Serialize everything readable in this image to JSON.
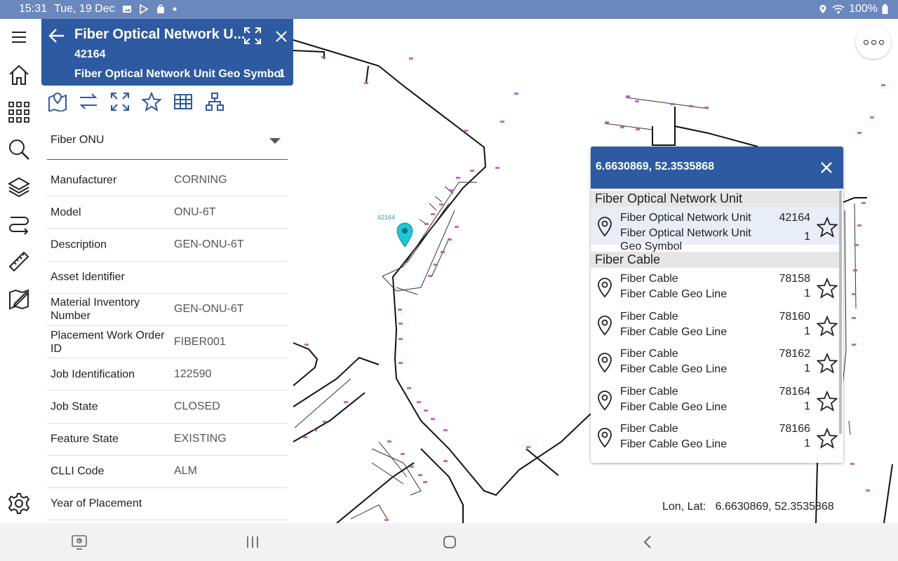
{
  "status_bar": {
    "time": "15:31",
    "date": "Tue, 19 Dec",
    "battery": "100%",
    "icons": [
      "photo-icon",
      "play-store-icon",
      "bag-icon",
      "dot-icon",
      "location-icon",
      "wifi-icon",
      "battery-icon"
    ]
  },
  "sidebar": {
    "items": [
      {
        "icon": "menu-icon"
      },
      {
        "icon": "home-icon"
      },
      {
        "icon": "apps-grid-icon"
      },
      {
        "icon": "search-icon"
      },
      {
        "icon": "layers-icon"
      },
      {
        "icon": "trace-icon"
      },
      {
        "icon": "measure-icon"
      },
      {
        "icon": "redline-icon"
      },
      {
        "icon": "settings-icon"
      }
    ]
  },
  "feature_panel": {
    "title": "Fiber Optical Network U...",
    "object_id": "42164",
    "subtype": "Fiber Optical Network Unit Geo Symbol",
    "count": "1",
    "toolbar_icons": [
      "map-zoom-icon",
      "swap-icon",
      "expand-icon",
      "favorite-star-icon",
      "table-icon",
      "hierarchy-icon"
    ],
    "layer_select": "Fiber ONU",
    "attributes": [
      {
        "label": "Manufacturer",
        "value": "CORNING"
      },
      {
        "label": "Model",
        "value": "ONU-6T"
      },
      {
        "label": "Description",
        "value": "GEN-ONU-6T"
      },
      {
        "label": "Asset Identifier",
        "value": ""
      },
      {
        "label": "Material Inventory Number",
        "value": "GEN-ONU-6T"
      },
      {
        "label": "Placement Work Order ID",
        "value": "FIBER001"
      },
      {
        "label": "Job Identification",
        "value": "122590"
      },
      {
        "label": "Job State",
        "value": "CLOSED"
      },
      {
        "label": "Feature State",
        "value": "EXISTING"
      },
      {
        "label": "CLLI Code",
        "value": "ALM"
      },
      {
        "label": "Year of Placement",
        "value": ""
      }
    ]
  },
  "map": {
    "marker_label": "42164",
    "lonlat_label": "Lon, Lat:",
    "lonlat_value": "6.6630869, 52.3535868"
  },
  "identify_panel": {
    "coords": "6.6630869, 52.3535868",
    "groups": [
      {
        "name": "Fiber Optical Network Unit",
        "items": [
          {
            "name": "Fiber Optical Network Unit",
            "sub": "Fiber Optical Network Unit Geo Symbol",
            "id": "42164",
            "count": "1"
          }
        ]
      },
      {
        "name": "Fiber Cable",
        "items": [
          {
            "name": "Fiber Cable",
            "sub": "Fiber Cable Geo Line",
            "id": "78158",
            "count": "1"
          },
          {
            "name": "Fiber Cable",
            "sub": "Fiber Cable Geo Line",
            "id": "78160",
            "count": "1"
          },
          {
            "name": "Fiber Cable",
            "sub": "Fiber Cable Geo Line",
            "id": "78162",
            "count": "1"
          },
          {
            "name": "Fiber Cable",
            "sub": "Fiber Cable Geo Line",
            "id": "78164",
            "count": "1"
          },
          {
            "name": "Fiber Cable",
            "sub": "Fiber Cable Geo Line",
            "id": "78166",
            "count": "1"
          }
        ]
      }
    ]
  },
  "nav_bar": {
    "icons": [
      "screenshot-icon",
      "recents-icon",
      "home-nav-icon",
      "back-icon"
    ]
  },
  "colors": {
    "status_bar": "#6b88be",
    "header_blue": "#2d5aa0",
    "icon_blue": "#2d5aa0",
    "marker": "#1fc6d6",
    "map_label": "#c040c0"
  }
}
